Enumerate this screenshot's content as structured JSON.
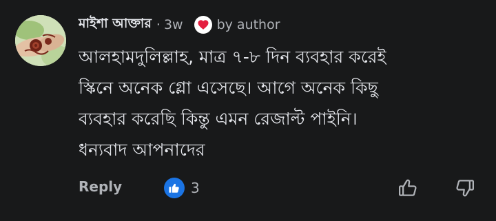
{
  "comment": {
    "author": "মাইশা আক্তার",
    "separator": "·",
    "time": "3w",
    "author_badge": "by author",
    "heart_color": "#e41e3f",
    "body_lines": [
      "আলহামদুলিল্লাহ, মাত্র ৭-৮ দিন ব্যবহার করেই",
      "স্কিনে অনেক গ্লো এসেছে। আগে অনেক কিছু",
      "ব্যবহার করেছি কিন্তু এমন রেজাল্ট পাইনি।",
      "ধন্যবাদ আপনাদের"
    ],
    "reply_label": "Reply",
    "like_count": "3",
    "like_color": "#1b74e4",
    "icons": {
      "reaction": "heart-icon",
      "like_badge": "thumbs-up-icon",
      "upvote": "thumbs-up-outline-icon",
      "downvote": "thumbs-down-outline-icon"
    }
  }
}
